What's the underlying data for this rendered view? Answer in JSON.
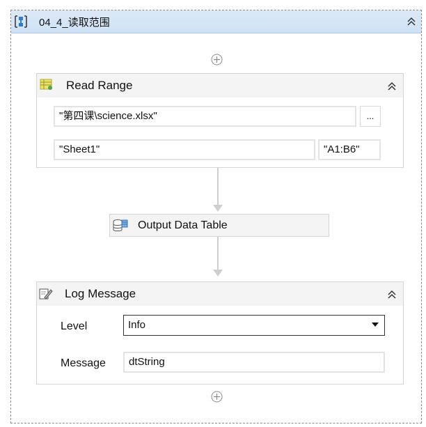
{
  "sequence": {
    "title": "04_4_读取范围",
    "collapse_icon": "double-chevron-up-icon",
    "add_icon": "plus-circle-icon"
  },
  "read_range": {
    "title": "Read Range",
    "icon": "excel-read-range-icon",
    "file_path": "\"第四课\\science.xlsx\"",
    "browse_label": "...",
    "sheet_name": "\"Sheet1\"",
    "range": "\"A1:B6\""
  },
  "output_data_table": {
    "title": "Output Data Table",
    "icon": "database-table-icon"
  },
  "log_message": {
    "title": "Log Message",
    "icon": "log-note-icon",
    "level_label": "Level",
    "level_value": "Info",
    "message_label": "Message",
    "message_value": "dtString"
  }
}
